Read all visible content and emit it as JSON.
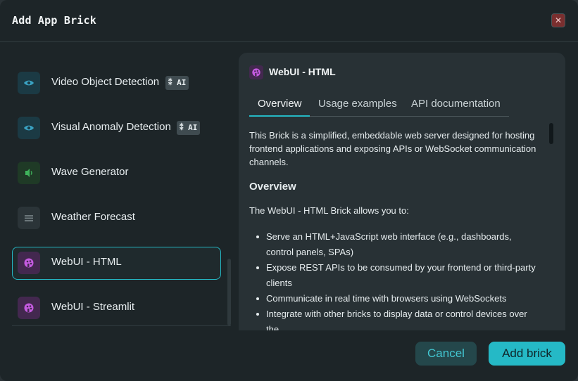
{
  "dialog": {
    "title": "Add App Brick",
    "close_glyph": "✕"
  },
  "bricks": [
    {
      "label": "Video Object Detection",
      "icon": "eye-icon",
      "ai": true
    },
    {
      "label": "Visual Anomaly Detection",
      "icon": "eye-icon",
      "ai": true
    },
    {
      "label": "Wave Generator",
      "icon": "wave-icon",
      "ai": false
    },
    {
      "label": "Weather Forecast",
      "icon": "cloud-icon",
      "ai": false
    },
    {
      "label": "WebUI - HTML",
      "icon": "palette-icon",
      "ai": false,
      "selected": true
    },
    {
      "label": "WebUI - Streamlit",
      "icon": "palette-icon",
      "ai": false
    }
  ],
  "ai_badge_label": "AI",
  "detail": {
    "title": "WebUI - HTML",
    "tabs": [
      "Overview",
      "Usage examples",
      "API documentation"
    ],
    "active_tab": "Overview",
    "intro": "This Brick is a simplified, embeddable web server designed for hosting frontend applications and exposing APIs or WebSocket communication channels.",
    "section_heading": "Overview",
    "allows": "The WebUI - HTML Brick allows you to:",
    "bullets": [
      "Serve an HTML+JavaScript web interface (e.g., dashboards, control panels, SPAs)",
      "Expose REST APIs to be consumed by your frontend or third-party clients",
      "Communicate in real time with browsers using WebSockets",
      "Integrate with other bricks to display data or control devices over the"
    ]
  },
  "footer": {
    "cancel_label": "Cancel",
    "add_label": "Add brick"
  },
  "colors": {
    "accent": "#25b9c6",
    "dialog_bg": "#1d2528",
    "panel_bg": "#283135"
  }
}
